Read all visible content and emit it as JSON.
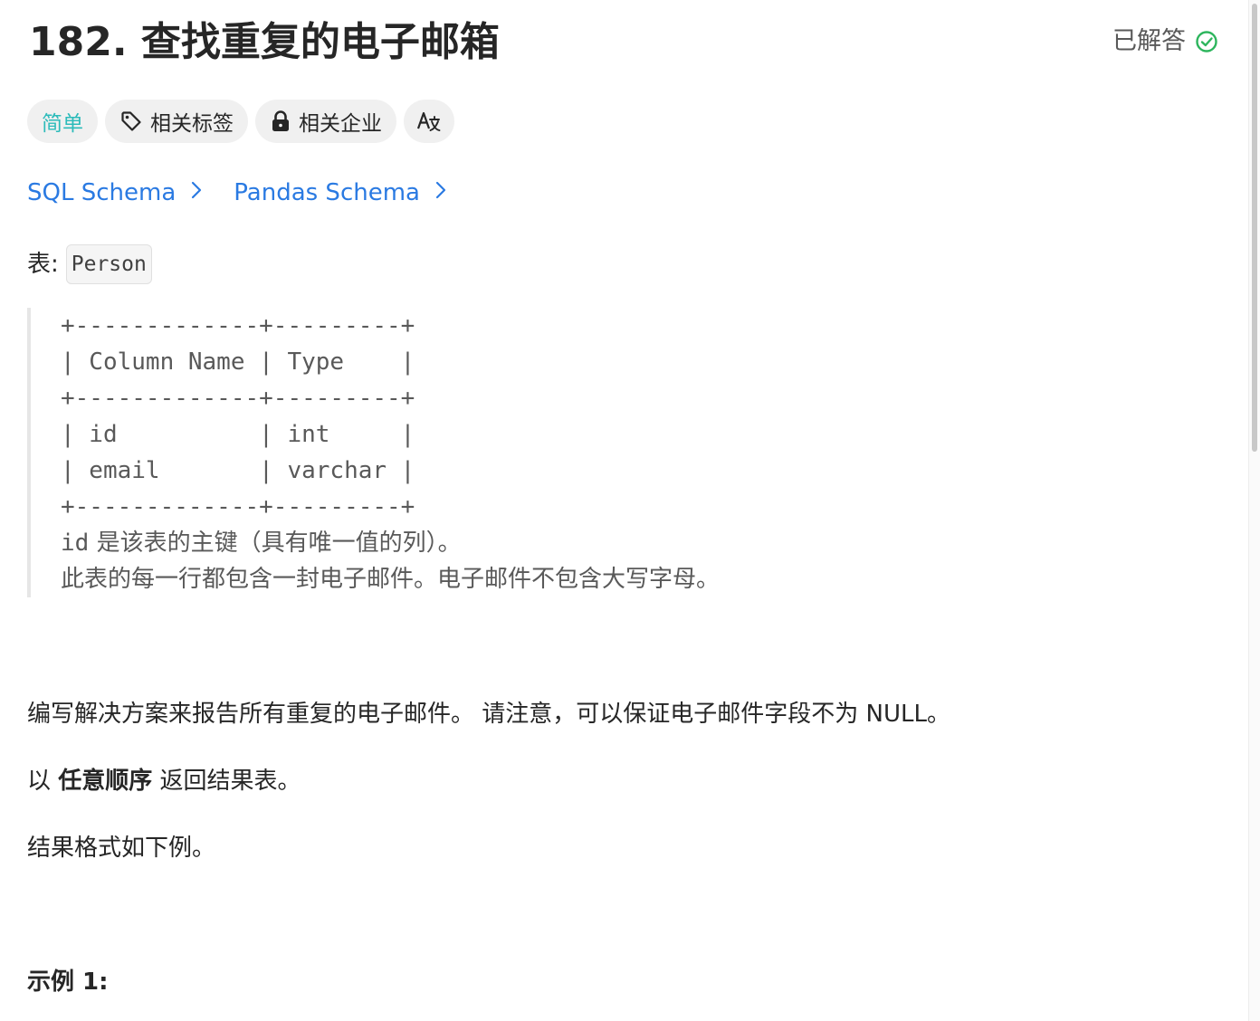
{
  "problem": {
    "title": "182. 查找重复的电子邮箱",
    "status_label": "已解答",
    "colors": {
      "difficulty": "#2cbbba",
      "link": "#2a7ae2",
      "solved_check": "#2db55d"
    }
  },
  "tags": {
    "difficulty": "简单",
    "related_tags": "相关标签",
    "related_companies": "相关企业",
    "translate_icon": "translate-icon"
  },
  "schemas": {
    "sql": "SQL Schema",
    "pandas": "Pandas Schema"
  },
  "table": {
    "prefix": "表:",
    "name": "Person",
    "ascii": "+-------------+---------+\n| Column Name | Type    |\n+-------------+---------+\n| id          | int     |\n| email       | varchar |\n+-------------+---------+",
    "note_mono": "id",
    "note_line1": " 是该表的主键（具有唯一值的列）。",
    "note_line2": "此表的每一行都包含一封电子邮件。电子邮件不包含大写字母。"
  },
  "description": {
    "line1": "编写解决方案来报告所有重复的电子邮件。 请注意，可以保证电子邮件字段不为 NULL。",
    "line2_prefix": "以 ",
    "line2_bold": "任意顺序",
    "line2_suffix": " 返回结果表。",
    "line3": "结果格式如下例。",
    "example_heading": "示例 1:"
  }
}
